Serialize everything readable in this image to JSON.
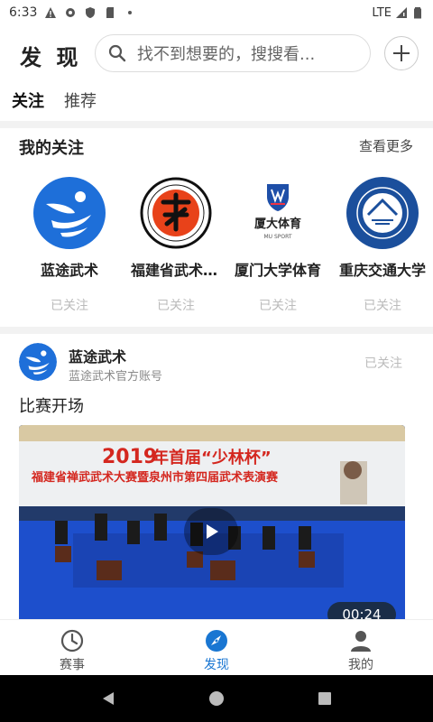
{
  "status_bar": {
    "time": "6:33",
    "network": "LTE"
  },
  "header": {
    "title": "发 现",
    "search_placeholder": "找不到想要的，搜搜看..."
  },
  "tabs": [
    {
      "label": "关注",
      "active": true
    },
    {
      "label": "推荐",
      "active": false
    }
  ],
  "my_follows": {
    "title": "我的关注",
    "see_more": "查看更多",
    "items": [
      {
        "name": "蓝途武术",
        "status": "已关注",
        "icon": "lantu-logo"
      },
      {
        "name": "福建省武术协会",
        "status": "已关注",
        "icon": "fujian-wushu-logo"
      },
      {
        "name": "厦门大学体育",
        "status": "已关注",
        "icon": "xmu-sport-logo"
      },
      {
        "name": "重庆交通大学",
        "status": "已关注",
        "icon": "cqjtu-logo"
      }
    ]
  },
  "xmu_logo_text": {
    "main": "厦大体育",
    "sub": "MU SPORT"
  },
  "post": {
    "author": "蓝途武术",
    "subtitle": "蓝途武术官方账号",
    "follow_status": "已关注",
    "title": "比赛开场",
    "video": {
      "banner_year": "2019",
      "banner_title": "年首届“少林杯”",
      "banner_subtitle": "福建省禅武武术大赛暨泉州市第四届武术表演赛",
      "duration": "00:24"
    }
  },
  "bottom_nav": [
    {
      "label": "赛事",
      "icon": "clock-icon",
      "active": false
    },
    {
      "label": "发现",
      "icon": "compass-icon",
      "active": true
    },
    {
      "label": "我的",
      "icon": "person-icon",
      "active": false
    }
  ],
  "colors": {
    "accent": "#1976d2",
    "lantu_blue": "#1e6fd9",
    "muted": "#bbbbbb"
  }
}
